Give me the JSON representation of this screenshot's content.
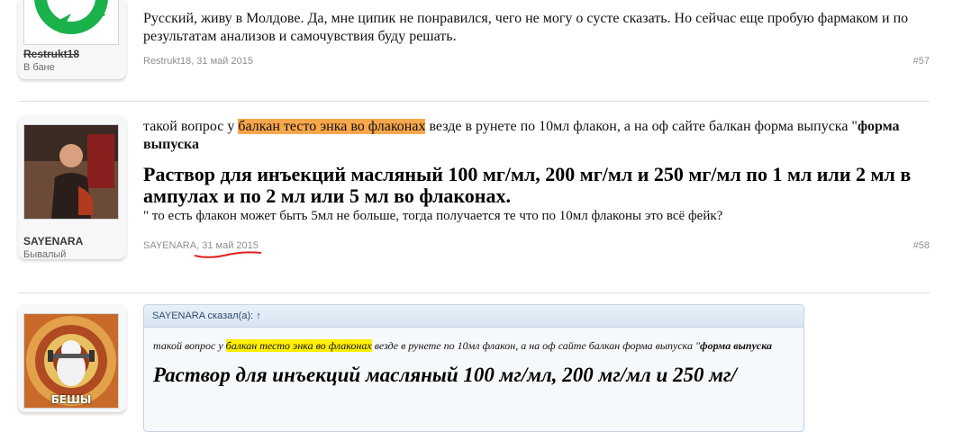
{
  "posts": [
    {
      "username": "Restrukt18",
      "user_title": "В бане",
      "text": "Русский, живу в Молдове. Да, мне ципик не понравился, чего не могу о сусте сказать. Но сейчас еще пробую фармаком и по результатам анализов и самочувствия буду решать.",
      "meta": "Restrukt18, 31 май 2015",
      "number": "#57"
    },
    {
      "username": "SAYENARA",
      "user_title": "Бывалый",
      "text_pre": "такой вопрос у ",
      "text_highlight": "балкан тесто энка во флаконах",
      "text_post": " везде в рунете по 10мл флакон, а на оф сайте балкан форма выпуска \"",
      "text_bold": "форма выпуска",
      "big_text": "Раствор для инъекций масляный 100 мг/мл, 200 мг/мл и 250 мг/мл по 1 мл или 2 мл в ампулах и по 2 мл или 5 мл во флаконах.",
      "text_after": "\" то есть флакон может быть 5мл не больше, тогда получается те что по 10мл флаконы это всё фейк?",
      "meta_author": "SAYENARA,",
      "meta_date": "31 май 2015",
      "number": "#58"
    },
    {
      "avatar_caption": "БЕШЫ",
      "quote_header": "SAYENARA сказал(а): ↑",
      "quote_pre": "такой вопрос у ",
      "quote_highlight": "балкан тесто энка во флаконах",
      "quote_post": " везде в рунете по 10мл флакон, а на оф сайте балкан форма выпуска \"",
      "quote_bold": "форма выпуска",
      "quote_big": "Раствор для инъекций масляный 100 мг/мл, 200 мг/мл и 250 мг/"
    }
  ],
  "colors": {
    "highlight_orange": "#f7a64b",
    "highlight_yellow": "#ffef00",
    "annotation_red": "#e02020"
  },
  "icons": [
    "recycle-logo-icon",
    "user-photo-avatar",
    "hypnotic-cat-avatar"
  ]
}
